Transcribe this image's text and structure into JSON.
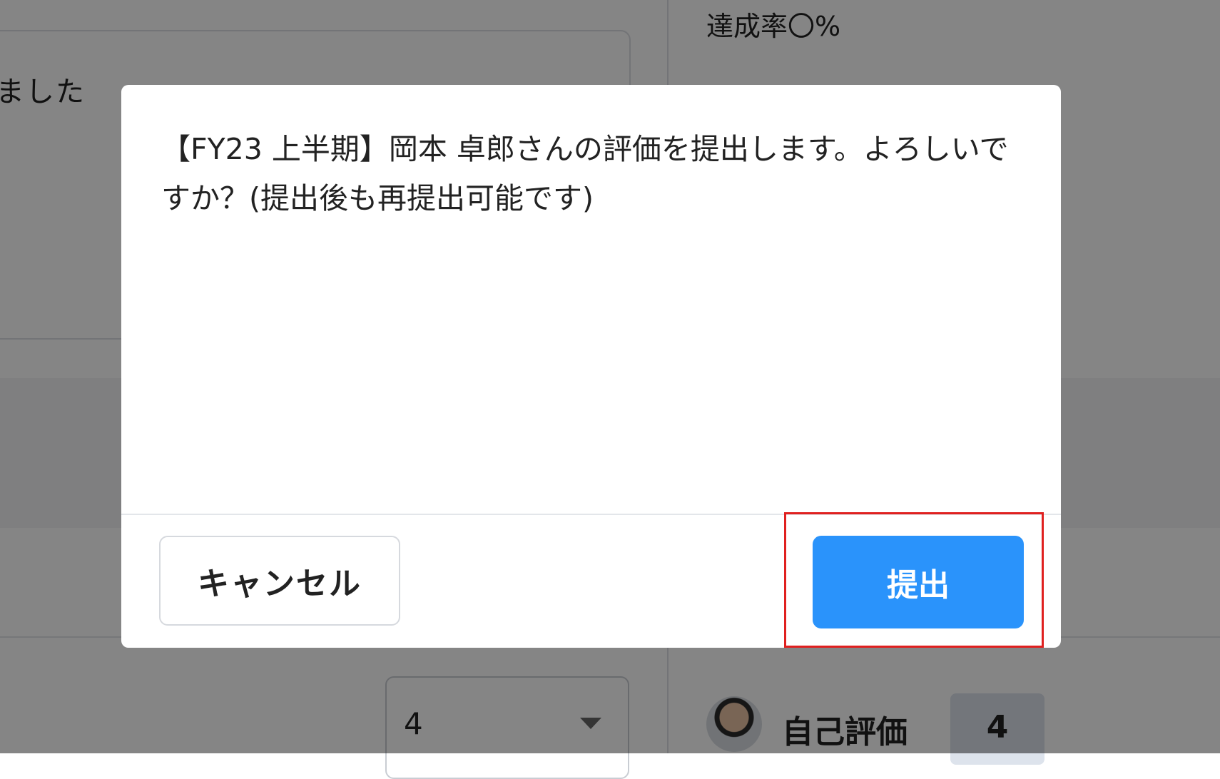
{
  "background": {
    "partial_text": "ました",
    "achievement_rate": "達成率〇%",
    "select_value": "4",
    "self_evaluation_label": "自己評価",
    "self_evaluation_score": "4"
  },
  "dialog": {
    "message": "【FY23 上半期】岡本 卓郎さんの評価を提出します。よろしいですか？(提出後も再提出可能です)",
    "cancel_label": "キャンセル",
    "submit_label": "提出"
  },
  "colors": {
    "primary": "#2a93fb",
    "highlight": "#e0201f"
  }
}
